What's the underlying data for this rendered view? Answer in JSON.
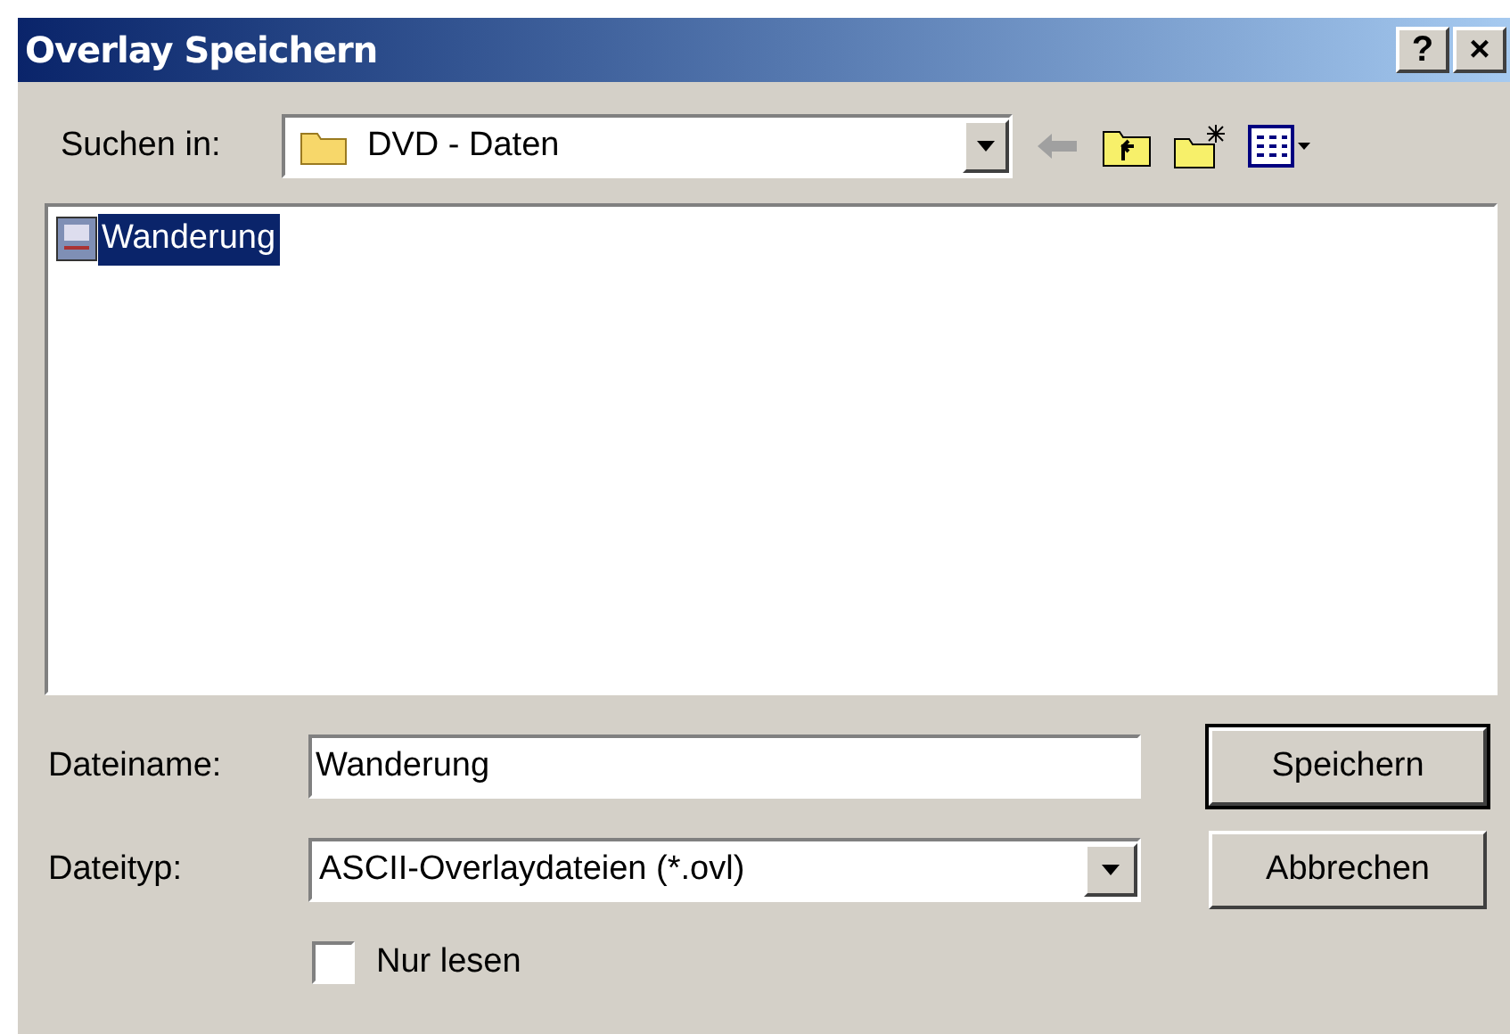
{
  "window": {
    "title": "Overlay Speichern",
    "title_buttons": [
      "?",
      "×"
    ]
  },
  "look_in": {
    "label": "Suchen in:",
    "value": "DVD - Daten"
  },
  "files": [
    {
      "name": "Wanderung",
      "selected": true
    }
  ],
  "filename": {
    "label": "Dateiname:",
    "value": "Wanderung"
  },
  "filetype": {
    "label": "Dateityp:",
    "value": "ASCII-Overlaydateien (*.ovl)"
  },
  "read_only": {
    "label": "Nur lesen",
    "checked": false
  },
  "buttons": [
    {
      "label": "Speichern",
      "default": true
    },
    {
      "label": "Abbrechen",
      "default": false
    }
  ]
}
